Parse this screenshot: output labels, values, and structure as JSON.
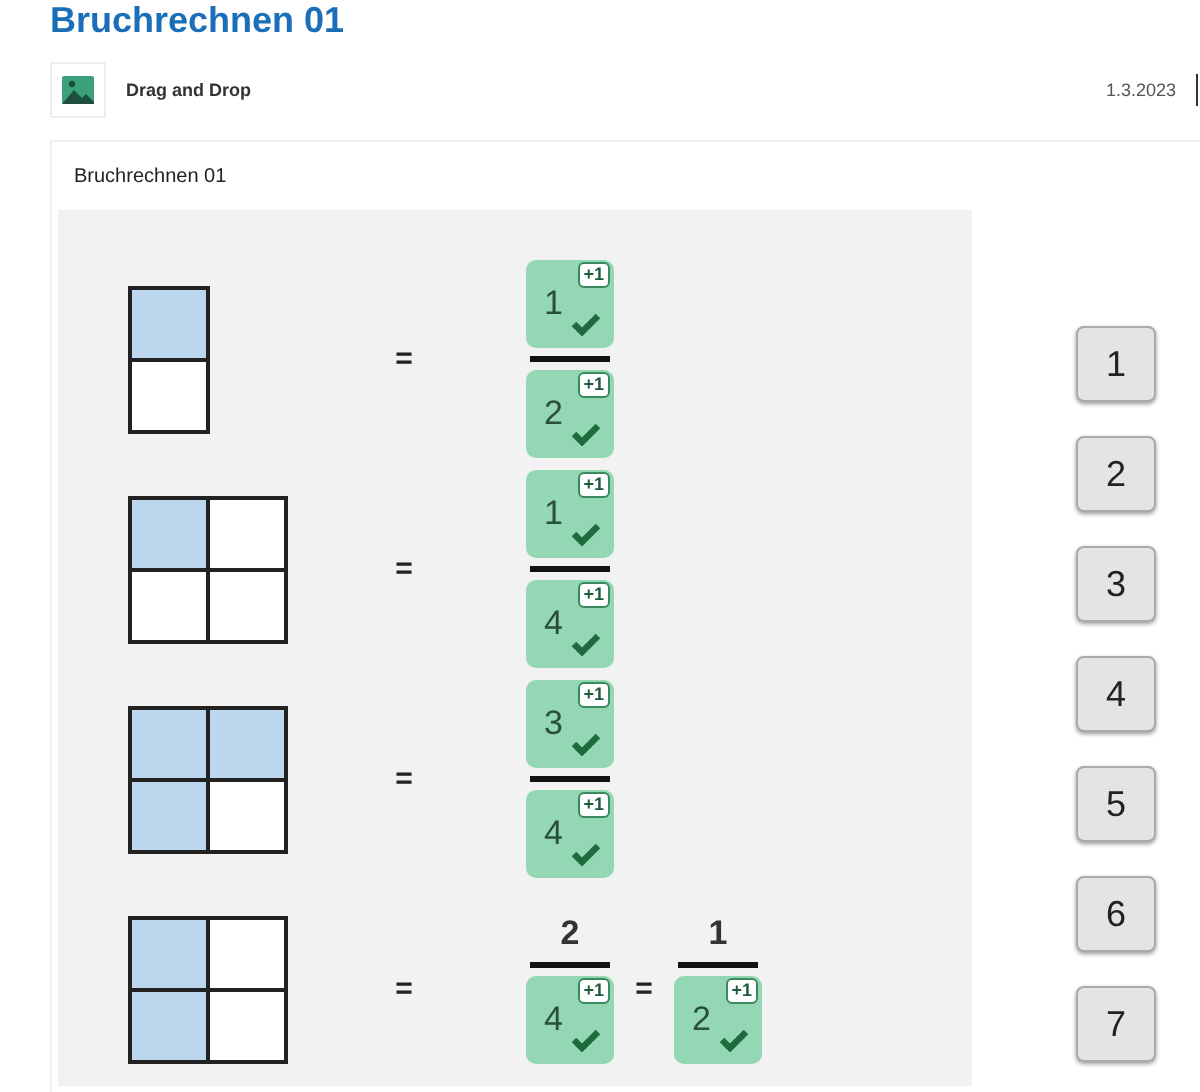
{
  "title": "Bruchrechnen 01",
  "entry": {
    "type": "Drag and Drop",
    "date": "1.3.2023"
  },
  "task": {
    "title": "Bruchrechnen 01",
    "rows": [
      {
        "grid": [
          {
            "cells": [
              {
                "filled": true
              }
            ]
          },
          {
            "cells": [
              {
                "filled": false
              }
            ]
          }
        ],
        "items": [
          {
            "kind": "equals",
            "text": "="
          },
          {
            "kind": "fraction",
            "numerator": {
              "kind": "drop",
              "value": "1",
              "badge": "+1",
              "correct": true
            },
            "denominator": {
              "kind": "drop",
              "value": "2",
              "badge": "+1",
              "correct": true
            }
          }
        ]
      },
      {
        "grid": [
          {
            "cells": [
              {
                "filled": true
              },
              {
                "filled": false
              }
            ]
          },
          {
            "cells": [
              {
                "filled": false
              },
              {
                "filled": false
              }
            ]
          }
        ],
        "items": [
          {
            "kind": "equals",
            "text": "="
          },
          {
            "kind": "fraction",
            "numerator": {
              "kind": "drop",
              "value": "1",
              "badge": "+1",
              "correct": true
            },
            "denominator": {
              "kind": "drop",
              "value": "4",
              "badge": "+1",
              "correct": true
            }
          }
        ]
      },
      {
        "grid": [
          {
            "cells": [
              {
                "filled": true
              },
              {
                "filled": true
              }
            ]
          },
          {
            "cells": [
              {
                "filled": true
              },
              {
                "filled": false
              }
            ]
          }
        ],
        "items": [
          {
            "kind": "equals",
            "text": "="
          },
          {
            "kind": "fraction",
            "numerator": {
              "kind": "drop",
              "value": "3",
              "badge": "+1",
              "correct": true
            },
            "denominator": {
              "kind": "drop",
              "value": "4",
              "badge": "+1",
              "correct": true
            }
          }
        ]
      },
      {
        "grid": [
          {
            "cells": [
              {
                "filled": true
              },
              {
                "filled": false
              }
            ]
          },
          {
            "cells": [
              {
                "filled": true
              },
              {
                "filled": false
              }
            ]
          }
        ],
        "items": [
          {
            "kind": "equals",
            "text": "="
          },
          {
            "kind": "fraction",
            "numerator": {
              "kind": "text",
              "value": "2"
            },
            "denominator": {
              "kind": "drop",
              "value": "4",
              "badge": "+1",
              "correct": true
            }
          },
          {
            "kind": "equals",
            "text": "="
          },
          {
            "kind": "fraction",
            "numerator": {
              "kind": "text",
              "value": "1"
            },
            "denominator": {
              "kind": "drop",
              "value": "2",
              "badge": "+1",
              "correct": true
            }
          }
        ]
      }
    ],
    "tokens": [
      "1",
      "2",
      "3",
      "4",
      "5",
      "6",
      "7"
    ]
  }
}
